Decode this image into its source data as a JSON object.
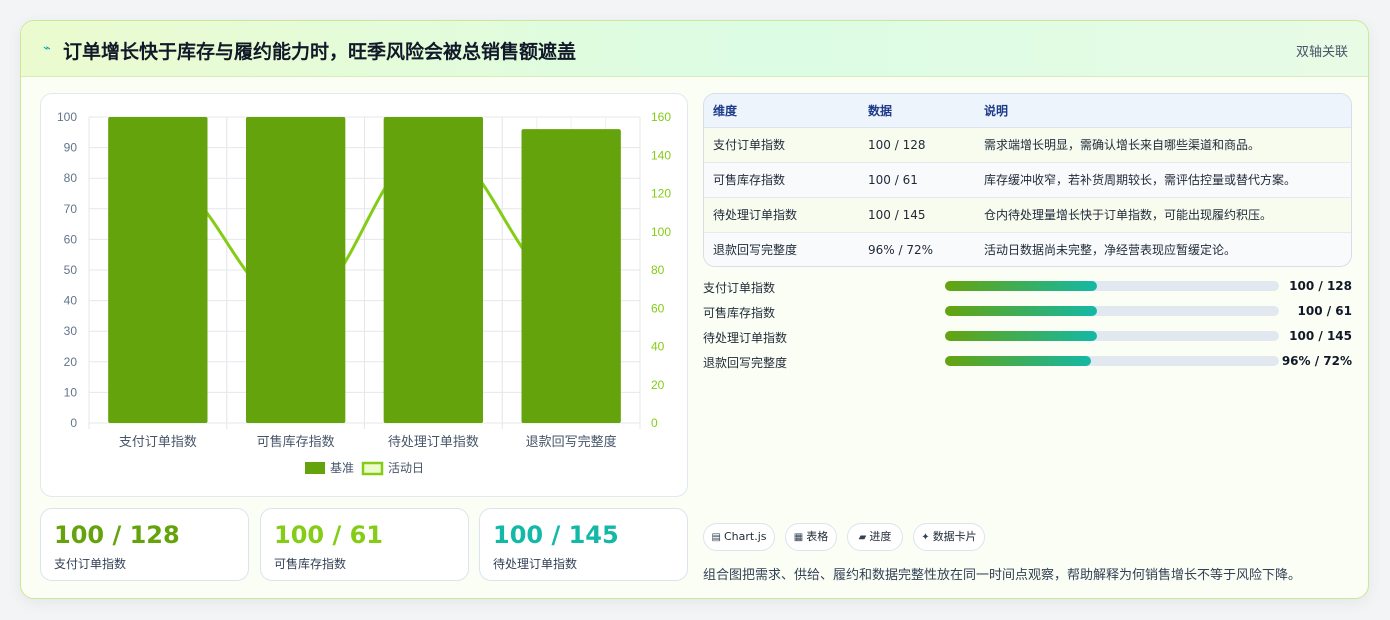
{
  "header": {
    "icon": "trend-spark-icon",
    "title": "订单增长快于库存与履约能力时，旺季风险会被总销售额遮盖",
    "badge": "双轴关联"
  },
  "chart_data": {
    "type": "bar",
    "categories": [
      "支付订单指数",
      "可售库存指数",
      "待处理订单指数",
      "退款回写完整度"
    ],
    "series": [
      {
        "name": "基准",
        "type": "bar",
        "axis": "left",
        "values": [
          100,
          100,
          100,
          96
        ],
        "color": "#65a30d"
      },
      {
        "name": "活动日",
        "type": "line",
        "axis": "right",
        "values": [
          128,
          61,
          145,
          72
        ],
        "color": "#84cc16"
      }
    ],
    "y_left": {
      "min": 0,
      "max": 100,
      "ticks": [
        "0",
        "10",
        "20",
        "30",
        "40",
        "50",
        "60",
        "70",
        "80",
        "90",
        "100"
      ]
    },
    "y_right": {
      "min": 0,
      "max": 160,
      "ticks": [
        "0",
        "20",
        "40",
        "60",
        "80",
        "100",
        "120",
        "140",
        "160"
      ]
    },
    "grid": true,
    "legend": "bottom-center"
  },
  "kpis": [
    {
      "value": "100 / 128",
      "label": "支付订单指数",
      "color": "#65a30d"
    },
    {
      "value": "100 / 61",
      "label": "可售库存指数",
      "color": "#84cc16"
    },
    {
      "value": "100 / 145",
      "label": "待处理订单指数",
      "color": "#14b8a6"
    }
  ],
  "table": {
    "headers": [
      "维度",
      "数据",
      "说明"
    ],
    "rows": [
      [
        "支付订单指数",
        "100 / 128",
        "需求端增长明显，需确认增长来自哪些渠道和商品。"
      ],
      [
        "可售库存指数",
        "100 / 61",
        "库存缓冲收窄，若补货周期较长，需评估控量或替代方案。"
      ],
      [
        "待处理订单指数",
        "100 / 145",
        "仓内待处理量增长快于订单指数，可能出现履约积压。"
      ],
      [
        "退款回写完整度",
        "96% / 72%",
        "活动日数据尚未完整，净经营表现应暂缓定论。"
      ]
    ]
  },
  "progress": [
    {
      "label": "支付订单指数",
      "value": "100 / 128",
      "fill": 0.455
    },
    {
      "label": "可售库存指数",
      "value": "100 / 61",
      "fill": 0.455
    },
    {
      "label": "待处理订单指数",
      "value": "100 / 145",
      "fill": 0.455
    },
    {
      "label": "退款回写完整度",
      "value": "96% / 72%",
      "fill": 0.437
    }
  ],
  "chips": [
    {
      "icon": "chart-icon",
      "glyph": "▤",
      "label": "Chart.js"
    },
    {
      "icon": "table-icon",
      "glyph": "▦",
      "label": "表格"
    },
    {
      "icon": "progress-icon",
      "glyph": "▰",
      "label": "进度"
    },
    {
      "icon": "sparkle-icon",
      "glyph": "✦",
      "label": "数据卡片"
    }
  ],
  "note": "组合图把需求、供给、履约和数据完整性放在同一时间点观察，帮助解释为何销售增长不等于风险下降。"
}
